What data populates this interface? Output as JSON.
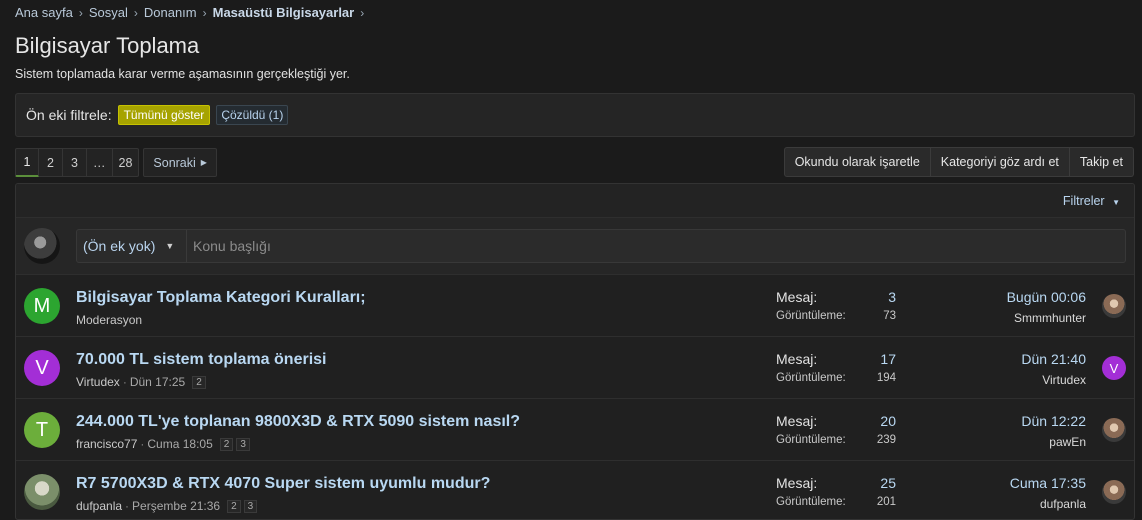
{
  "breadcrumb": [
    {
      "label": "Ana sayfa"
    },
    {
      "label": "Sosyal"
    },
    {
      "label": "Donanım"
    },
    {
      "label": "Masaüstü Bilgisayarlar"
    }
  ],
  "page": {
    "title": "Bilgisayar Toplama",
    "description": "Sistem toplamada karar verme aşamasının gerçekleştiği yer."
  },
  "prefix_filter": {
    "label": "Ön eki filtrele:",
    "show_all": "Tümünü göster",
    "solved": "Çözüldü (1)"
  },
  "pagination": {
    "pages": [
      "1",
      "2",
      "3",
      "…",
      "28"
    ],
    "next": "Sonraki"
  },
  "actions": {
    "mark_read": "Okundu olarak işaretle",
    "ignore_category": "Kategoriyi göz ardı et",
    "follow": "Takip et"
  },
  "filters": {
    "label": "Filtreler"
  },
  "quick_thread": {
    "prefix": "(Ön ek yok)",
    "placeholder": "Konu başlığı"
  },
  "colors": {
    "accent_link": "#b9d8f2",
    "prefix_all": "#a6a300"
  },
  "threads": [
    {
      "avatar_letter": "M",
      "avatar_color": "#2ca530",
      "title": "Bilgisayar Toplama Kategori Kuralları;",
      "author": "Moderasyon",
      "date": "",
      "pages": [],
      "replies_label": "Mesaj:",
      "replies": "3",
      "views_label": "Görüntüleme:",
      "views": "73",
      "last_time": "Bugün 00:06",
      "last_user": "Smmmhunter",
      "last_avatar_icon": "user-photo-icon"
    },
    {
      "avatar_letter": "V",
      "avatar_color": "#a32ed6",
      "title": "70.000 TL sistem toplama önerisi",
      "author": "Virtudex",
      "date": "Dün 17:25",
      "pages": [
        "2"
      ],
      "replies_label": "Mesaj:",
      "replies": "17",
      "views_label": "Görüntüleme:",
      "views": "194",
      "last_time": "Dün 21:40",
      "last_user": "Virtudex",
      "last_avatar_letter": "V"
    },
    {
      "avatar_letter": "T",
      "avatar_color": "#6cae3b",
      "title": "244.000 TL'ye toplanan 9800X3D & RTX 5090 sistem nasıl?",
      "author": "francisco77",
      "date": "Cuma 18:05",
      "pages": [
        "2",
        "3"
      ],
      "replies_label": "Mesaj:",
      "replies": "20",
      "views_label": "Görüntüleme:",
      "views": "239",
      "last_time": "Dün 12:22",
      "last_user": "pawEn",
      "last_avatar_icon": "user-photo-icon"
    },
    {
      "avatar_letter": "",
      "avatar_color": "#7b8f6a",
      "title": "R7 5700X3D & RTX 4070 Super sistem uyumlu mudur?",
      "author": "dufpanla",
      "date": "Perşembe 21:36",
      "pages": [
        "2",
        "3"
      ],
      "replies_label": "Mesaj:",
      "replies": "25",
      "views_label": "Görüntüleme:",
      "views": "201",
      "last_time": "Cuma 17:35",
      "last_user": "dufpanla",
      "last_avatar_icon": "user-photo-icon"
    }
  ]
}
